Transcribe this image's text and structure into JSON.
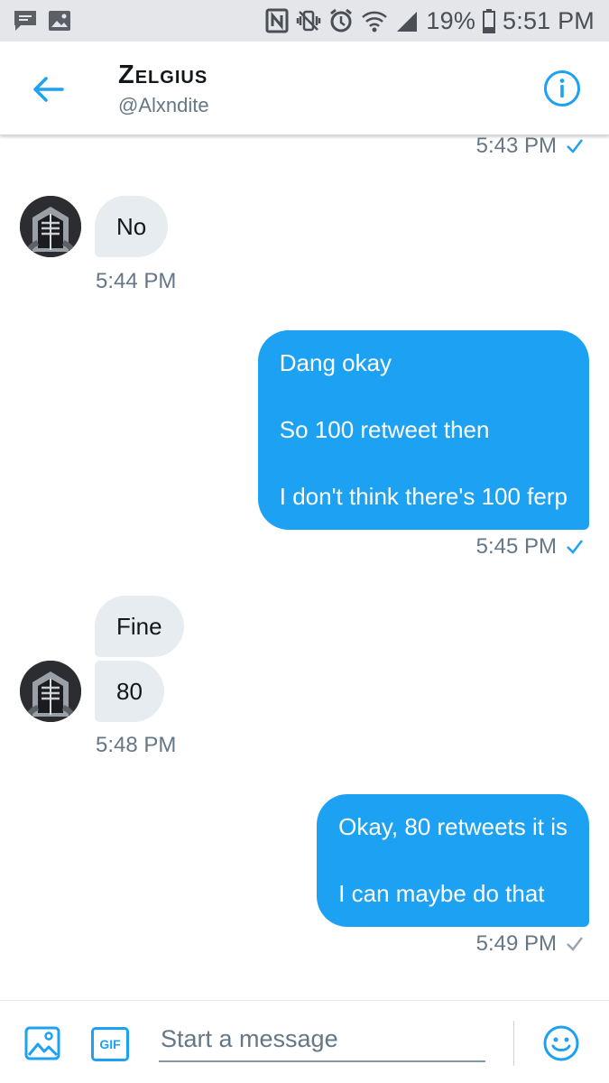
{
  "status_bar": {
    "left_icons": [
      "chat-notification-icon",
      "image-notification-icon"
    ],
    "right_icons": [
      "nfc-icon",
      "vibrate-icon",
      "alarm-icon",
      "wifi-icon",
      "signal-icon"
    ],
    "battery": "19%",
    "time": "5:51 PM"
  },
  "header": {
    "title": "Zelgius",
    "handle": "@Alxndite",
    "back_icon": "arrow-left-icon",
    "info_icon": "info-icon"
  },
  "messages": [
    {
      "direction": "out",
      "time": "5:43 PM",
      "status": "read"
    },
    {
      "direction": "in",
      "texts": [
        "No"
      ],
      "time": "5:44 PM"
    },
    {
      "direction": "out",
      "lines": [
        "Dang okay",
        "So 100 retweet then",
        "I don't think there's 100 ferp"
      ],
      "time": "5:45 PM",
      "status": "read"
    },
    {
      "direction": "in",
      "texts": [
        "Fine",
        "80"
      ],
      "time": "5:48 PM"
    },
    {
      "direction": "out",
      "lines": [
        "Okay, 80 retweets it is",
        "I can maybe do that"
      ],
      "time": "5:49 PM",
      "status": "sent"
    }
  ],
  "composer": {
    "placeholder": "Start a message",
    "gif_label": "GIF",
    "photo_icon": "photo-icon",
    "emoji_icon": "emoji-icon"
  },
  "colors": {
    "accent": "#1da1f2",
    "incoming_bubble": "#e6ecf0",
    "timestamp": "#657786",
    "status_bar_bg": "#e4e6e9",
    "read_check": "#1da1f2",
    "sent_check": "#9aa5b1"
  }
}
